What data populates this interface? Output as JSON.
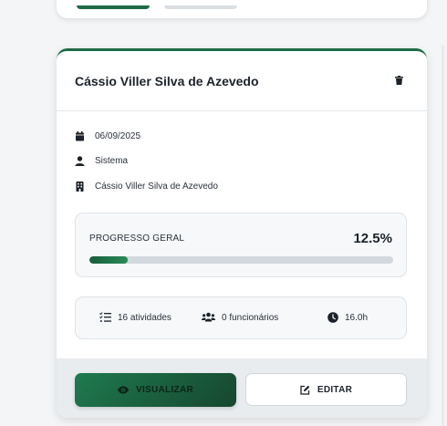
{
  "card": {
    "title": "Cássio Viller Silva de Azevedo",
    "info": {
      "date": "06/09/2025",
      "creator": "Sistema",
      "company": "Cássio Viller Silva de Azevedo"
    },
    "progress": {
      "label": "PROGRESSO GERAL",
      "value_text": "12.5%",
      "value": 12.5
    },
    "stats": {
      "activities": "16 atividades",
      "employees": "0 funcionários",
      "hours": "16.0h"
    },
    "actions": {
      "view_label": "VISUALIZAR",
      "edit_label": "EDITAR"
    }
  },
  "icons": {
    "delete": "trash-icon",
    "date": "calendar-icon",
    "creator": "user-icon",
    "company": "building-icon",
    "activities": "list-check-icon",
    "employees": "users-icon",
    "hours": "clock-icon",
    "view": "eye-icon",
    "edit": "edit-icon"
  },
  "colors": {
    "accent": "#1f6b45",
    "progress_fill": "#1a5c3b",
    "progress_track": "#d3d8dd"
  }
}
